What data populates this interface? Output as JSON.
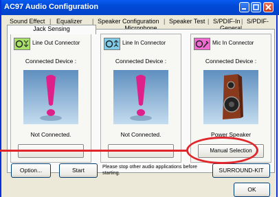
{
  "window": {
    "title": "AC97 Audio Configuration"
  },
  "tabs_row1": [
    "Sound Effect",
    "Equalizer",
    "Speaker Configuration",
    "Speaker Test",
    "S/PDIF-In",
    "S/PDIF-Out"
  ],
  "tabs_row2": [
    "Jack Sensing",
    "Microphone",
    "General"
  ],
  "panels": [
    {
      "connector": "Line Out Connector",
      "device_label": "Connected Device :",
      "status": "Not Connected.",
      "button": "",
      "icon_color": "#a8e06a"
    },
    {
      "connector": "Line In Connector",
      "device_label": "Connected Device :",
      "status": "Not Connected.",
      "button": "",
      "icon_color": "#7fcbe8"
    },
    {
      "connector": "Mic In Connector",
      "device_label": "Connected Device :",
      "status": "Power Speaker",
      "button": "Manual Selection",
      "icon_color": "#f06bd0"
    }
  ],
  "buttons": {
    "option": "Option...",
    "start": "Start",
    "surround": "SURROUND-KIT",
    "ok": "OK"
  },
  "message": "Please stop other audio applications before starting.",
  "colors": {
    "title_bar": "#0149d6",
    "highlight": "#e0262b"
  }
}
